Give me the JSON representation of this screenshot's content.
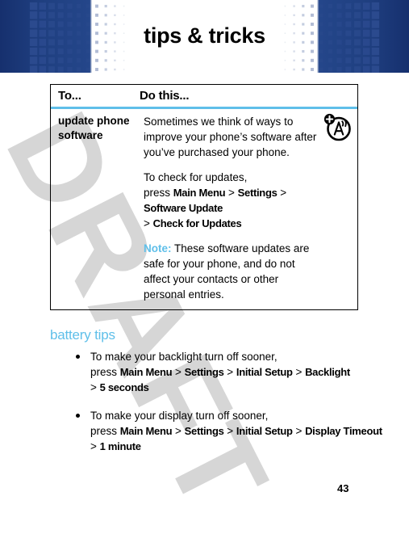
{
  "header": {
    "title": "tips & tricks",
    "band_color_dark": "#16306e",
    "band_color_mid": "#24468a"
  },
  "watermark": {
    "text": "DRAFT",
    "color": "#d6d6d6"
  },
  "accent": {
    "light_blue": "#5fbfe9",
    "navy": "#1f3f80"
  },
  "table": {
    "columns": [
      "To...",
      "Do this..."
    ],
    "rows": [
      {
        "to": "update phone software",
        "icon": "software-update-icon",
        "paragraphs": [
          {
            "type": "plain",
            "text": "Sometimes we think of ways to improve your phone’s software after you’ve purchased your phone."
          },
          {
            "type": "menu-path",
            "lead": "To check for updates,",
            "press": "press",
            "path": [
              "Main Menu",
              "Settings",
              "Software Update",
              "Check for Updates"
            ]
          },
          {
            "type": "note",
            "label": "Note:",
            "text": "These software updates are safe for your phone, and do not affect your contacts or other personal entries."
          }
        ]
      }
    ]
  },
  "battery_tips": {
    "heading": "battery tips",
    "bullets": [
      {
        "lead": "To make your backlight turn off sooner,",
        "press": "press",
        "path": [
          "Main Menu",
          "Settings",
          "Initial Setup",
          "Backlight",
          "5 seconds"
        ]
      },
      {
        "lead": "To make your display turn off sooner,",
        "press": "press",
        "path": [
          "Main Menu",
          "Settings",
          "Initial Setup",
          "Display Timeout",
          "1 minute"
        ]
      }
    ]
  },
  "footer": {
    "page_number": "43"
  }
}
